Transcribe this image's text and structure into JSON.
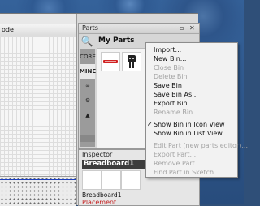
{
  "left_tab": {
    "label": "ode"
  },
  "parts_panel": {
    "title": "Parts",
    "bin_title": "My Parts",
    "search_icon": "magnifier-icon",
    "bins": [
      {
        "label": "CORE",
        "selected": false
      },
      {
        "label": "MINE",
        "selected": true
      },
      {
        "label": "∞",
        "selected": false
      },
      {
        "label": "⚙",
        "selected": false
      },
      {
        "label": "▲",
        "selected": false
      }
    ]
  },
  "inspector": {
    "title": "Inspector",
    "selected_name": "Breadboard1",
    "board_label": "Breadboard1",
    "section": "Placement"
  },
  "context_menu": {
    "items": [
      {
        "label": "Import...",
        "enabled": true,
        "checked": false
      },
      {
        "label": "New Bin...",
        "enabled": true,
        "checked": false
      },
      {
        "label": "Close Bin",
        "enabled": false,
        "checked": false
      },
      {
        "label": "Delete Bin",
        "enabled": false,
        "checked": false
      },
      {
        "label": "Save Bin",
        "enabled": true,
        "checked": false
      },
      {
        "label": "Save Bin As...",
        "enabled": true,
        "checked": false
      },
      {
        "label": "Export Bin...",
        "enabled": true,
        "checked": false
      },
      {
        "label": "Rename Bin...",
        "enabled": false,
        "checked": false
      },
      {
        "label": "Show Bin in Icon View",
        "enabled": true,
        "checked": true
      },
      {
        "label": "Show Bin in List View",
        "enabled": true,
        "checked": false
      },
      {
        "label": "Edit Part (new parts editor)...",
        "enabled": false,
        "checked": false
      },
      {
        "label": "Export Part...",
        "enabled": false,
        "checked": false
      },
      {
        "label": "Remove Part",
        "enabled": false,
        "checked": false
      },
      {
        "label": "Find Part in Sketch",
        "enabled": false,
        "checked": false
      }
    ]
  }
}
